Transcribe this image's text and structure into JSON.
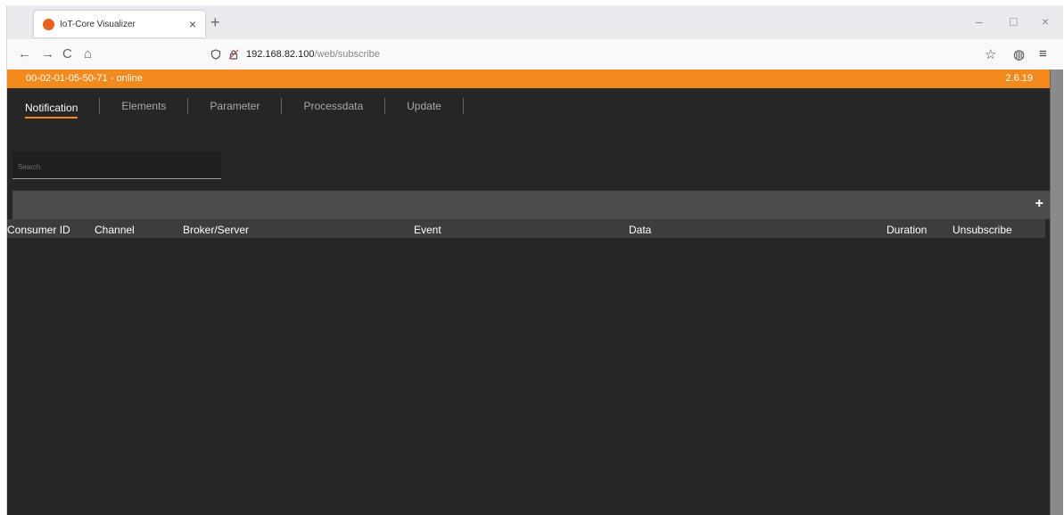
{
  "browser": {
    "tab_title": "IoT-Core Visualizer",
    "tab_close": "×",
    "new_tab": "+",
    "window_controls": {
      "minimize": "–",
      "maximize": "□",
      "close": "×"
    },
    "nav": {
      "back": "←",
      "forward": "→",
      "reload": "C",
      "home": "⌂"
    },
    "url_host": "192.168.82.100",
    "url_path": "/web/subscribe",
    "right_icons": {
      "bookmark": "☆",
      "extension": "◍",
      "menu": "≡"
    }
  },
  "app": {
    "device_status": "00-02-01-05-50-71 - online",
    "version": "2.6.19",
    "tabs": [
      {
        "label": "Notification"
      },
      {
        "label": "Elements"
      },
      {
        "label": "Parameter"
      },
      {
        "label": "Processdata"
      },
      {
        "label": "Update"
      }
    ],
    "search_placeholder": "Search",
    "add_label": "+",
    "columns": [
      "Consumer ID",
      "Channel",
      "Broker/Server",
      "Event",
      "Data",
      "Duration",
      "Unsubscribe"
    ]
  },
  "colors": {
    "accent": "#f28a1e",
    "background": "#262626"
  }
}
